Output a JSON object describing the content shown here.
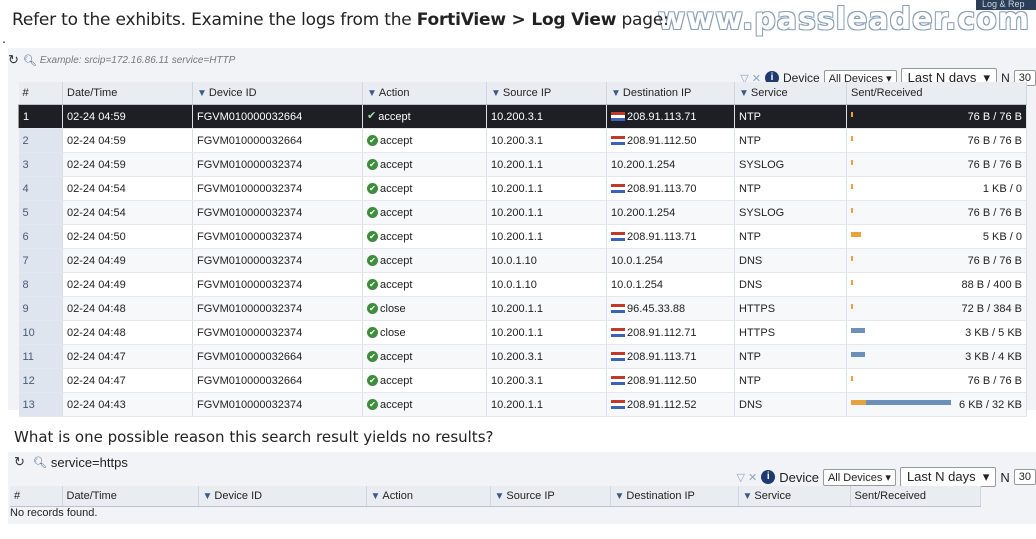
{
  "question_number": ".",
  "watermark": "www.passleader.com",
  "corner_tab": "Log & Rep",
  "question": {
    "prefix": "Refer to the exhibits. Examine the logs from the ",
    "bold": "FortiView > Log View",
    "suffix": " page:"
  },
  "top": {
    "search_placeholder": "Example: srcip=172.16.86.11 service=HTTP",
    "device_label": "Device",
    "device_select": "All Devices",
    "time_select": "Last N days",
    "n_label": "N",
    "n_value": "30",
    "columns": [
      "#",
      "Date/Time",
      "Device ID",
      "Action",
      "Source IP",
      "Destination IP",
      "Service",
      "Sent/Received"
    ],
    "rows": [
      {
        "n": "1",
        "dt": "02-24 04:59",
        "dev": "FGVM010000032664",
        "act": "accept",
        "src": "10.200.3.1",
        "dst": "208.91.113.71",
        "flag": true,
        "svc": "NTP",
        "sr": "76 B / 76 B",
        "bar": 1
      },
      {
        "n": "2",
        "dt": "02-24 04:59",
        "dev": "FGVM010000032664",
        "act": "accept",
        "src": "10.200.3.1",
        "dst": "208.91.112.50",
        "flag": true,
        "svc": "NTP",
        "sr": "76 B / 76 B",
        "bar": 1
      },
      {
        "n": "3",
        "dt": "02-24 04:59",
        "dev": "FGVM010000032374",
        "act": "accept",
        "src": "10.200.1.1",
        "dst": "10.200.1.254",
        "flag": false,
        "svc": "SYSLOG",
        "sr": "76 B / 76 B",
        "bar": 1
      },
      {
        "n": "4",
        "dt": "02-24 04:54",
        "dev": "FGVM010000032374",
        "act": "accept",
        "src": "10.200.1.1",
        "dst": "208.91.113.70",
        "flag": true,
        "svc": "NTP",
        "sr": "1 KB / 0",
        "bar": 1
      },
      {
        "n": "5",
        "dt": "02-24 04:54",
        "dev": "FGVM010000032374",
        "act": "accept",
        "src": "10.200.1.1",
        "dst": "10.200.1.254",
        "flag": false,
        "svc": "SYSLOG",
        "sr": "76 B / 76 B",
        "bar": 1
      },
      {
        "n": "6",
        "dt": "02-24 04:50",
        "dev": "FGVM010000032374",
        "act": "accept",
        "src": "10.200.1.1",
        "dst": "208.91.113.71",
        "flag": true,
        "svc": "NTP",
        "sr": "5 KB / 0",
        "bar": 6
      },
      {
        "n": "7",
        "dt": "02-24 04:49",
        "dev": "FGVM010000032374",
        "act": "accept",
        "src": "10.0.1.10",
        "dst": "10.0.1.254",
        "flag": false,
        "svc": "DNS",
        "sr": "76 B / 76 B",
        "bar": 1
      },
      {
        "n": "8",
        "dt": "02-24 04:49",
        "dev": "FGVM010000032374",
        "act": "accept",
        "src": "10.0.1.10",
        "dst": "10.0.1.254",
        "flag": false,
        "svc": "DNS",
        "sr": "88 B / 400 B",
        "bar": 1
      },
      {
        "n": "9",
        "dt": "02-24 04:48",
        "dev": "FGVM010000032374",
        "act": "close",
        "src": "10.200.1.1",
        "dst": "96.45.33.88",
        "flag": true,
        "svc": "HTTPS",
        "sr": "72 B / 384 B",
        "bar": 1
      },
      {
        "n": "10",
        "dt": "02-24 04:48",
        "dev": "FGVM010000032374",
        "act": "close",
        "src": "10.200.1.1",
        "dst": "208.91.112.71",
        "flag": true,
        "svc": "HTTPS",
        "sr": "3 KB / 5 KB",
        "bar": 10
      },
      {
        "n": "11",
        "dt": "02-24 04:47",
        "dev": "FGVM010000032664",
        "act": "accept",
        "src": "10.200.3.1",
        "dst": "208.91.113.71",
        "flag": true,
        "svc": "NTP",
        "sr": "3 KB / 4 KB",
        "bar": 10
      },
      {
        "n": "12",
        "dt": "02-24 04:47",
        "dev": "FGVM010000032664",
        "act": "accept",
        "src": "10.200.3.1",
        "dst": "208.91.112.50",
        "flag": true,
        "svc": "NTP",
        "sr": "76 B / 76 B",
        "bar": 1
      },
      {
        "n": "13",
        "dt": "02-24 04:43",
        "dev": "FGVM010000032374",
        "act": "accept",
        "src": "10.200.1.1",
        "dst": "208.91.112.52",
        "flag": true,
        "svc": "DNS",
        "sr": "76 B / 76 B",
        "bar": 60
      }
    ],
    "last_row_extra_sr": "6 KB / 32 KB"
  },
  "question2": "What is one possible reason this search result yields no results?",
  "bottom": {
    "search_value": "service=https",
    "device_label": "Device",
    "device_select": "All Devices",
    "time_select": "Last N days",
    "n_label": "N",
    "n_value": "30",
    "columns": [
      "#",
      "Date/Time",
      "Device ID",
      "Action",
      "Source IP",
      "Destination IP",
      "Service",
      "Sent/Received"
    ],
    "empty": "No records found."
  },
  "colors": {
    "selected_row": "#1d1f24",
    "accept_icon": "#3e8e3e",
    "bar_orange": "#e6a23c",
    "bar_blue": "#6d90b8"
  }
}
